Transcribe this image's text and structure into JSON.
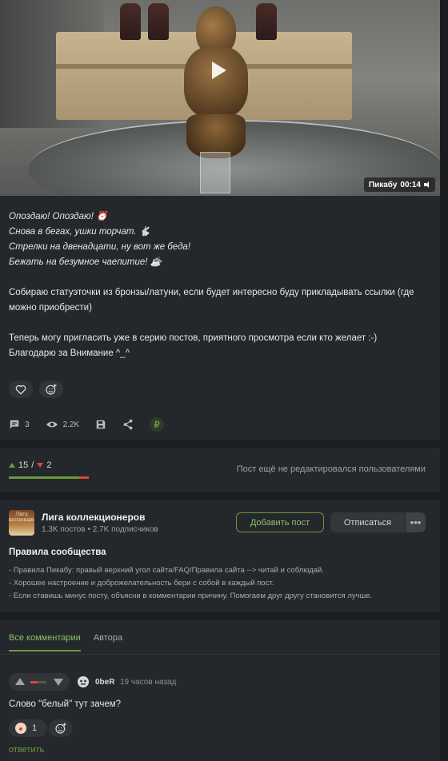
{
  "post": {
    "video": {
      "source": "Пикабу",
      "duration": "00:14"
    },
    "poem": [
      "Опоздаю! Опоздаю! ⏰",
      "Снова в бегах, ушки торчат. 🐇",
      "Стрелки на двенадцати, ну вот же беда!",
      "Бежать на безумное чаепитие! ☕"
    ],
    "paragraph1": "Собираю статуэточки из бронзы/латуни, если будет интересно буду прикладывать ссылки (где можно приобрести)",
    "paragraph2a": "Теперь могу пригласить уже в серию постов, приятного просмотра если кто желает :-)",
    "paragraph2b": "Благодарю за Внимание ^_^",
    "stats": {
      "comments": "3",
      "views": "2.2K"
    }
  },
  "rating": {
    "plus": "15",
    "separator": "/",
    "minus": "2",
    "positive_share": 0.88,
    "note": "Пост ещё не редактировался пользователями"
  },
  "community": {
    "logo_text": "Лига коллекционеров",
    "name": "Лига коллекционеров",
    "posts": "1.3K постов",
    "subscribers": "2.7K подписчиков",
    "add_post": "Добавить пост",
    "unsubscribe": "Отписаться",
    "more": "•••",
    "rules_title": "Правила сообщества",
    "rules": [
      "- Правила Пикабу: правый верхний угол сайта/FAQ/Правила сайта --> читай и соблюдай.",
      "- Хорошее настроение и доброжелательность бери с собой в каждый пост.",
      "- Если ставишь минус посту, объясни в комментарии причину. Помогаем друг другу становится лучше."
    ]
  },
  "comments": {
    "tabs": [
      "Все комментарии",
      "Автора"
    ],
    "items": [
      {
        "user": "0beR",
        "time": "19 часов назад",
        "text": "Слово \"белый\" тут зачем?",
        "reaction_count": "1",
        "reply": "ответить"
      }
    ]
  },
  "colors": {
    "accent": "#6b9a3e",
    "negative": "#e0443c",
    "background": "#1b1d20",
    "card": "#24272b"
  }
}
